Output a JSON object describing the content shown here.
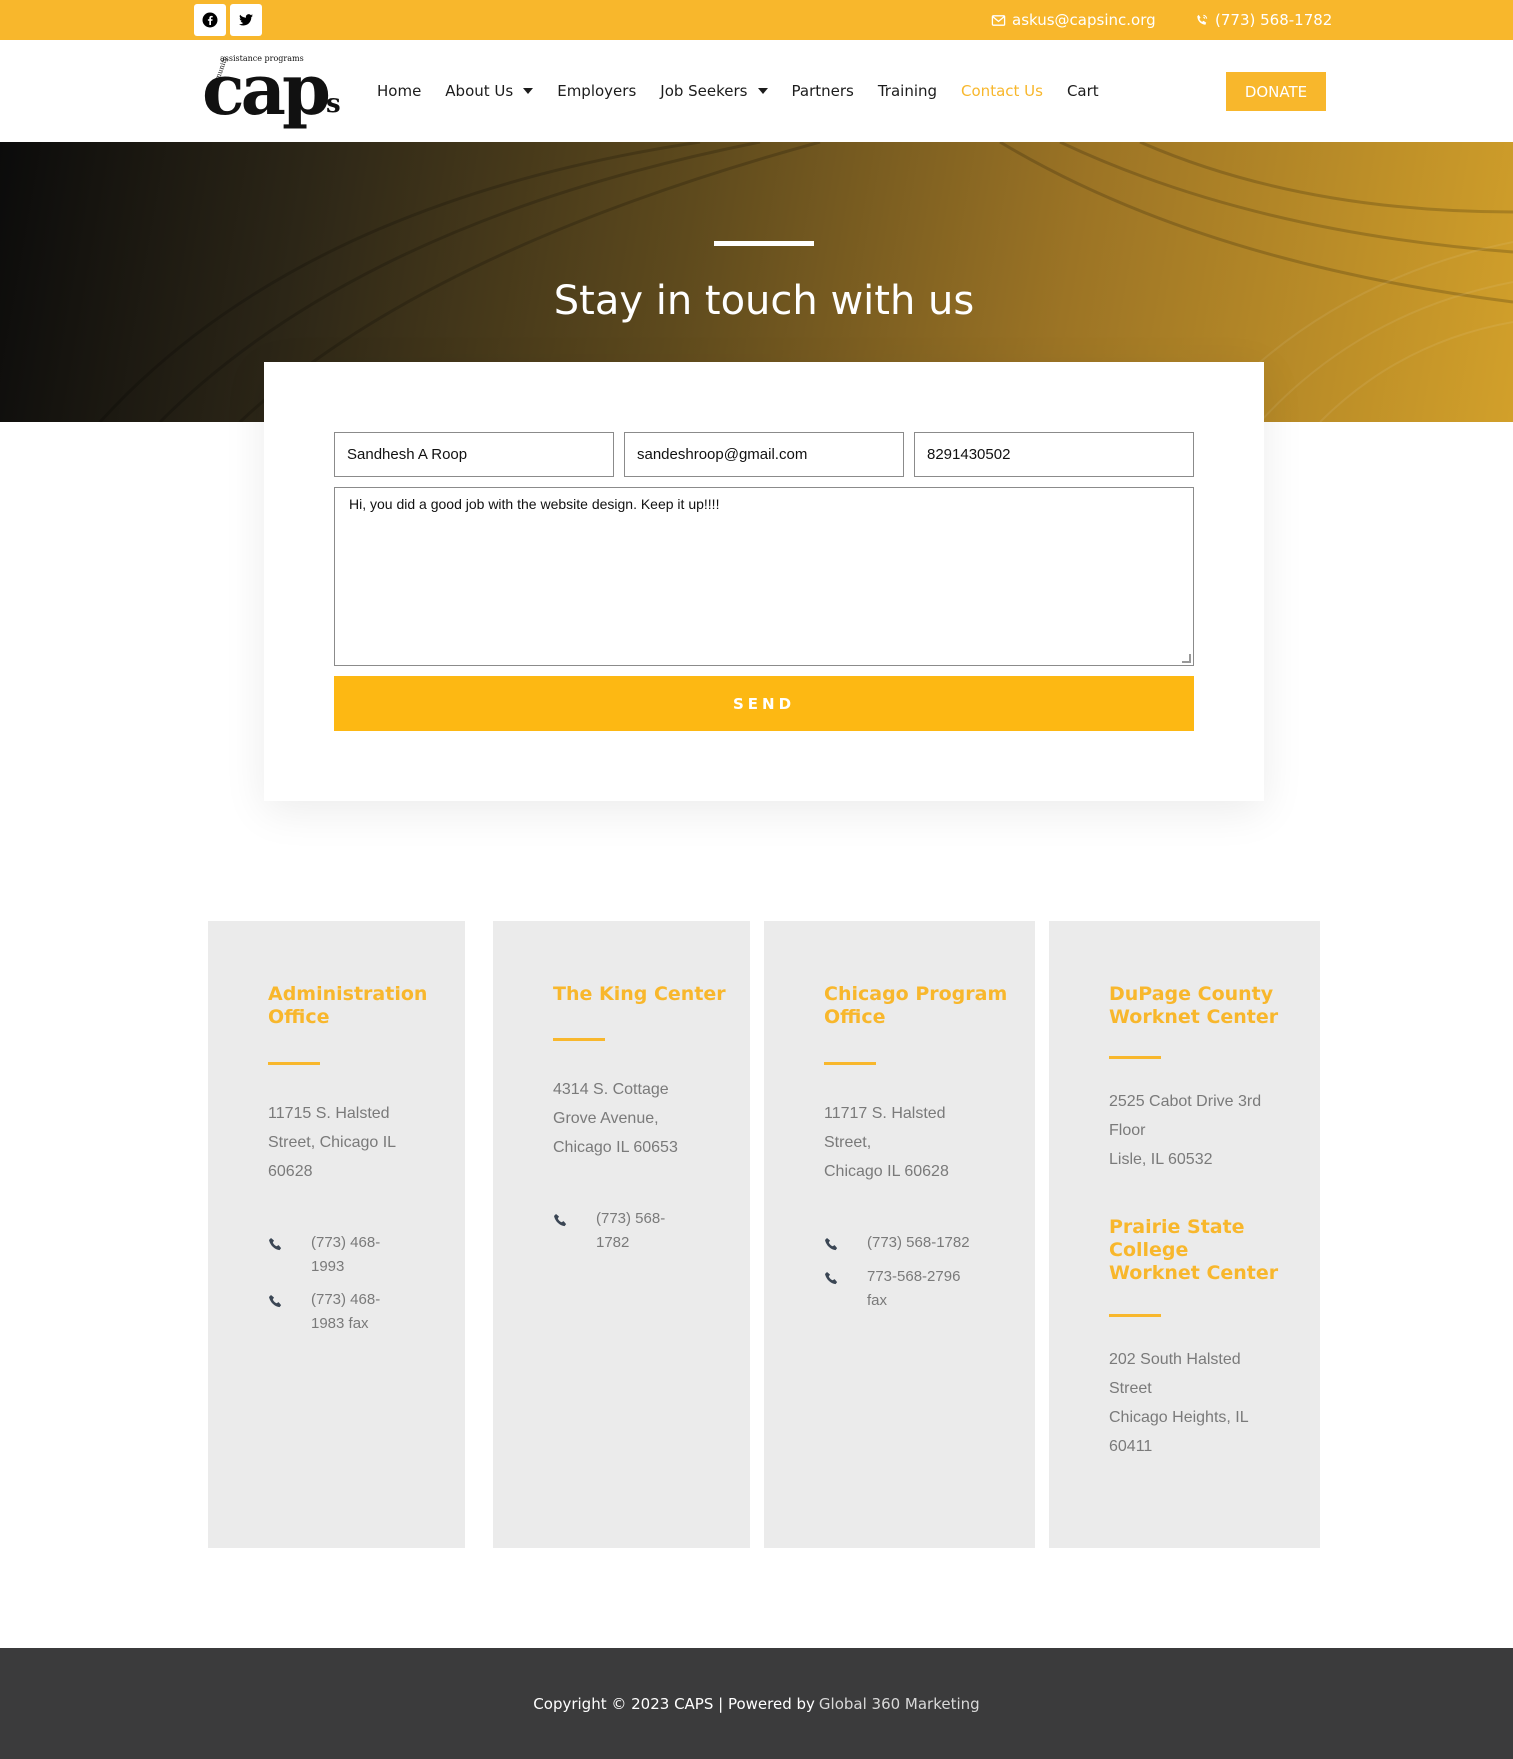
{
  "topbar": {
    "social": [
      {
        "icon": "facebook-icon"
      },
      {
        "icon": "twitter-icon"
      }
    ],
    "email": "askus@capsinc.org",
    "phone": "(773) 568-1782"
  },
  "header": {
    "logo_alt": "caps community assistance programs",
    "nav": [
      {
        "label": "Home",
        "dropdown": false
      },
      {
        "label": "About Us",
        "dropdown": true
      },
      {
        "label": "Employers",
        "dropdown": false
      },
      {
        "label": "Job Seekers",
        "dropdown": true
      },
      {
        "label": "Partners",
        "dropdown": false
      },
      {
        "label": "Training",
        "dropdown": false
      },
      {
        "label": "Contact Us",
        "dropdown": false,
        "active": true
      },
      {
        "label": "Cart",
        "dropdown": false
      }
    ],
    "donate_label": "DONATE"
  },
  "hero": {
    "title": "Stay in touch with us"
  },
  "form": {
    "name_value": "Sandhesh A Roop",
    "email_value": "sandeshroop@gmail.com",
    "phone_value": "8291430502",
    "message_value": "Hi, you did a good job with the website design. Keep it up!!!!",
    "send_label": "SEND"
  },
  "offices": [
    {
      "title": "Administration\nOffice",
      "address": "11715 S. Halsted\nStreet, Chicago IL\n60628",
      "phones": [
        "(773) 468-\n1993",
        "(773) 468-\n1983 fax"
      ]
    },
    {
      "title": "The King Center",
      "address": "4314 S. Cottage\nGrove Avenue,\nChicago IL 60653",
      "phones": [
        "(773) 568-\n1782"
      ]
    },
    {
      "title": "Chicago Program\nOffice",
      "address": "11717 S. Halsted\nStreet,\nChicago IL 60628",
      "phones": [
        "(773) 568-1782",
        "773-568-2796\nfax"
      ]
    },
    {
      "title": "DuPage County\nWorknet Center",
      "address": "2525 Cabot Drive 3rd\nFloor\nLisle, IL 60532",
      "title2": "Prairie State\nCollege\nWorknet Center",
      "address2": "202 South Halsted\nStreet\nChicago Heights, IL\n60411"
    }
  ],
  "footer": {
    "copyright": "Copyright © 2023 CAPS | Powered by",
    "link": "Global 360 Marketing"
  },
  "colors": {
    "accent": "#f8b72c",
    "send_button": "#fdb813",
    "footer_bg": "#3b3b3c",
    "office_card_bg": "#ebebeb"
  }
}
